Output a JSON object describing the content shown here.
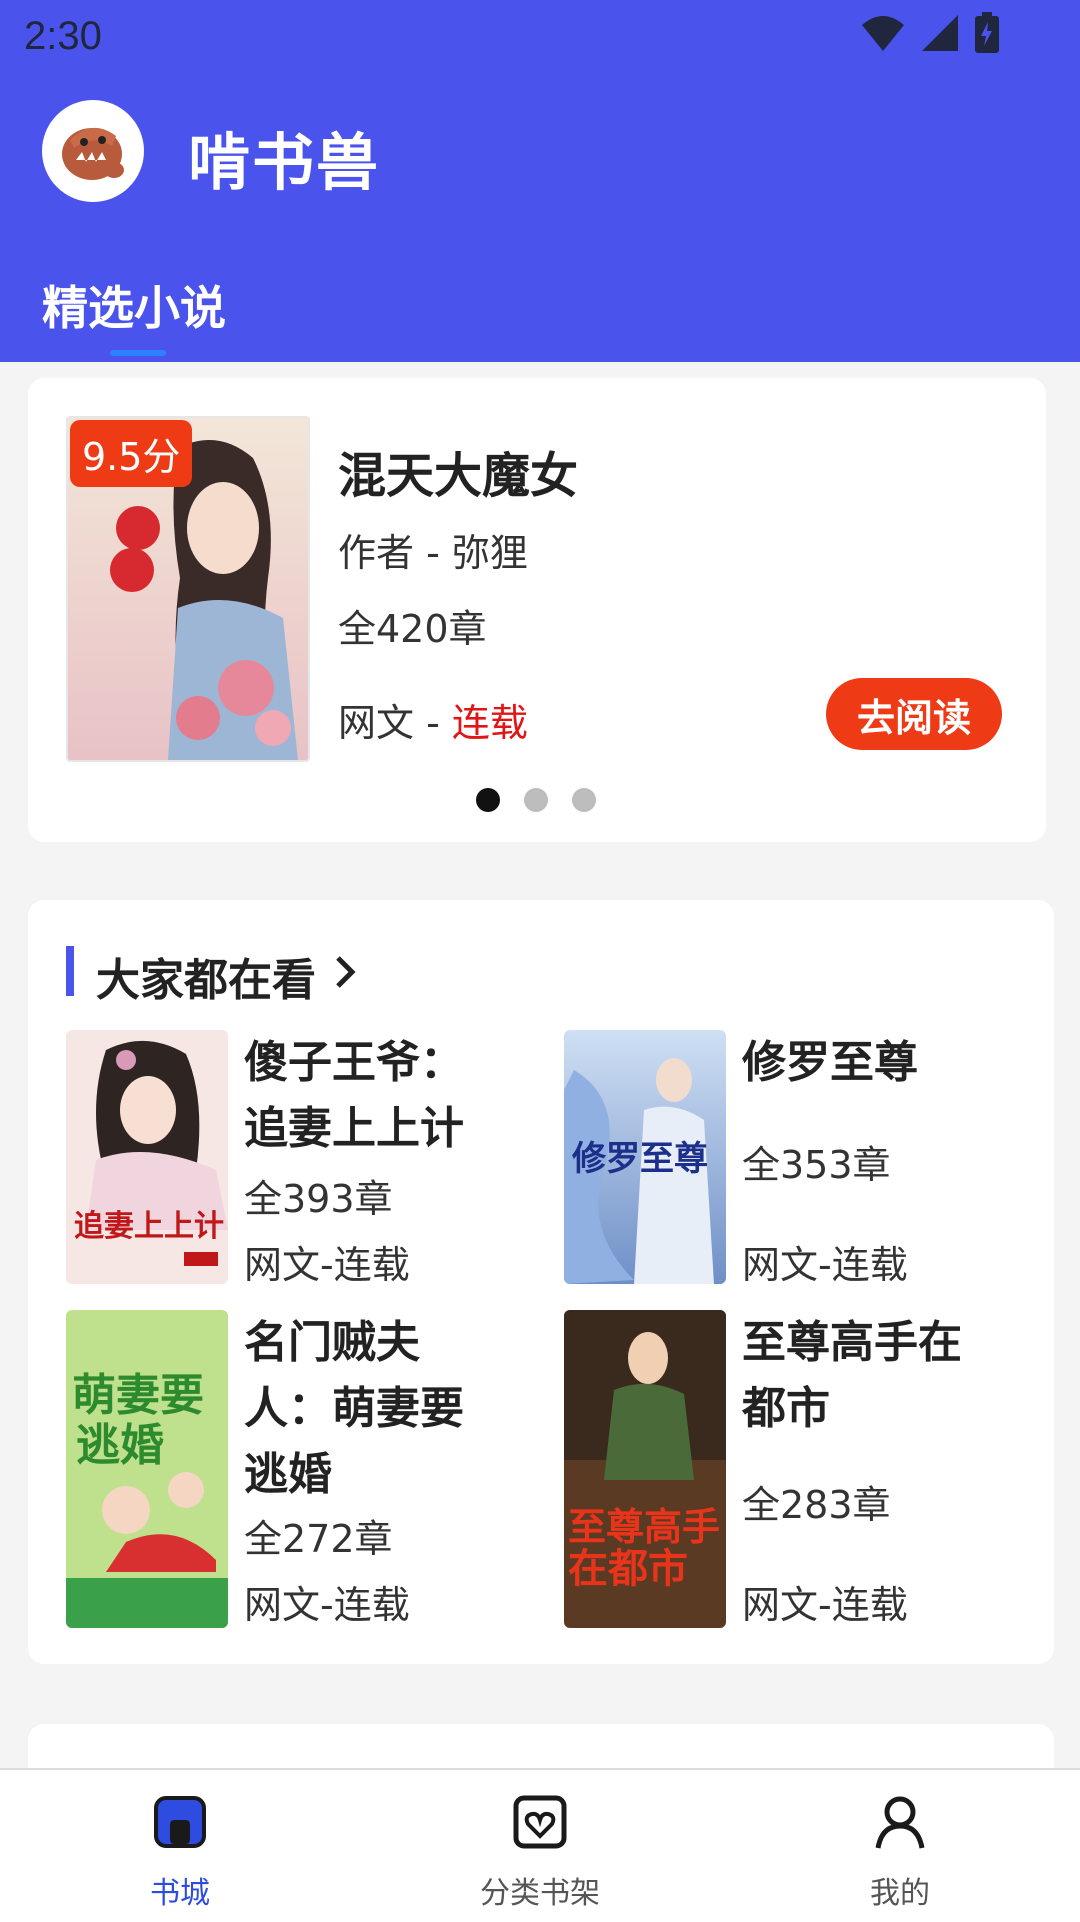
{
  "status_bar": {
    "time": "2:30"
  },
  "app": {
    "title": "啃书兽"
  },
  "tabs": [
    {
      "label": "精选小说",
      "active": true
    }
  ],
  "banner": {
    "score": "9.5分",
    "title": "混天大魔女",
    "author": "作者 - 弥狸",
    "chapters": "全420章",
    "category": "网文 - ",
    "status": "连载",
    "read_button": "去阅读",
    "carousel_count": 3,
    "carousel_active": 1
  },
  "popular": {
    "title": "大家都在看",
    "books": [
      {
        "title": "傻子王爷：追妻上上计",
        "chapters": "全393章",
        "status": "网文-连载"
      },
      {
        "title": "修罗至尊",
        "chapters": "全353章",
        "status": "网文-连载"
      },
      {
        "title": "名门贼夫人：萌妻要逃婚",
        "chapters": "全272章",
        "status": "网文-连载"
      },
      {
        "title": "至尊高手在都市",
        "chapters": "全283章",
        "status": "网文-连载"
      }
    ]
  },
  "bottom_nav": [
    {
      "label": "书城",
      "icon": "book-city-icon",
      "active": true
    },
    {
      "label": "分类书架",
      "icon": "bookshelf-heart-icon",
      "active": false
    },
    {
      "label": "我的",
      "icon": "user-icon",
      "active": false
    }
  ],
  "colors": {
    "brand_blue": "#4a54ec",
    "accent_red": "#ef3a16",
    "active_nav": "#2f4ce0"
  }
}
